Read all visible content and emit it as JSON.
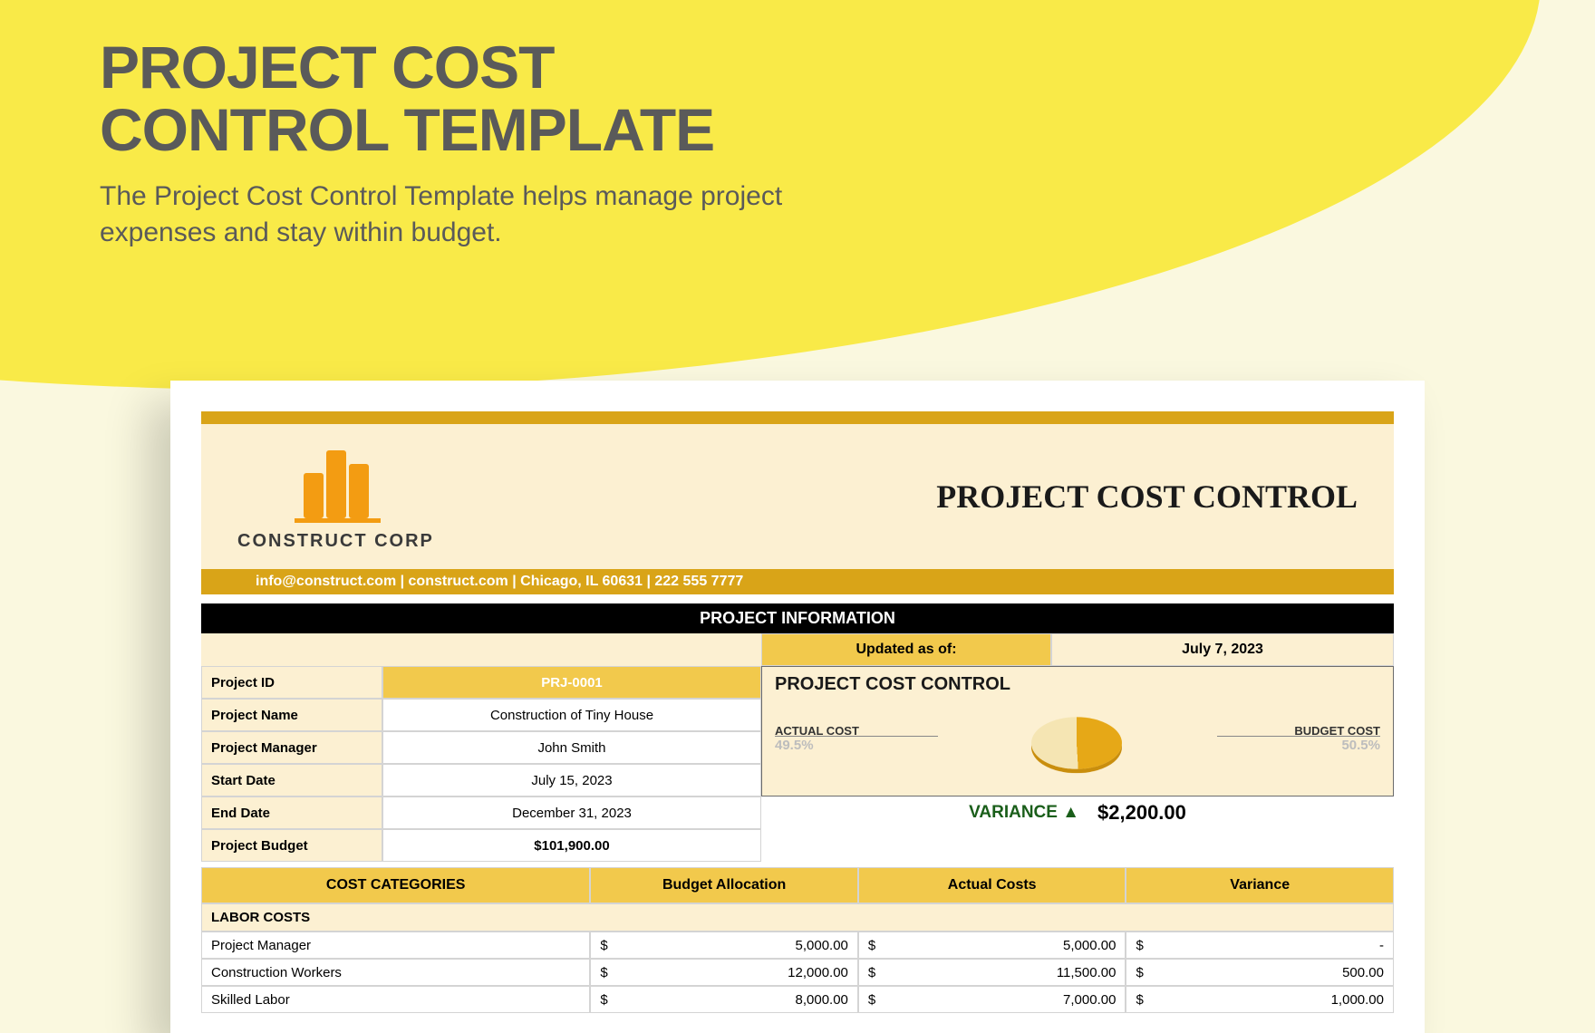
{
  "header": {
    "title_line1": "PROJECT COST",
    "title_line2": "CONTROL TEMPLATE",
    "subtitle": "The Project Cost Control Template helps manage project expenses and stay within budget."
  },
  "company": {
    "name": "CONSTRUCT CORP",
    "contact": "info@construct.com | construct.com | Chicago, IL 60631 | 222 555 7777"
  },
  "doc_title": "PROJECT COST CONTROL",
  "section_project_info": "PROJECT INFORMATION",
  "updated_label": "Updated as of:",
  "updated_value": "July 7, 2023",
  "info": {
    "project_id_label": "Project ID",
    "project_id": "PRJ-0001",
    "project_name_label": "Project Name",
    "project_name": "Construction of Tiny House",
    "project_manager_label": "Project Manager",
    "project_manager": "John Smith",
    "start_date_label": "Start Date",
    "start_date": "July 15, 2023",
    "end_date_label": "End Date",
    "end_date": "December 31, 2023",
    "project_budget_label": "Project Budget",
    "project_budget": "$101,900.00"
  },
  "chart": {
    "title": "PROJECT COST CONTROL",
    "actual_label": "ACTUAL COST",
    "actual_pct": "49.5%",
    "budget_label": "BUDGET COST",
    "budget_pct": "50.5%",
    "variance_label": "VARIANCE ▲",
    "variance_value": "$2,200.00"
  },
  "chart_data": {
    "type": "pie",
    "title": "PROJECT COST CONTROL",
    "series": [
      {
        "name": "ACTUAL COST",
        "values": [
          49.5
        ]
      },
      {
        "name": "BUDGET COST",
        "values": [
          50.5
        ]
      }
    ]
  },
  "columns": {
    "categories": "COST CATEGORIES",
    "budget": "Budget Allocation",
    "actual": "Actual Costs",
    "variance": "Variance"
  },
  "group_label": "LABOR COSTS",
  "rows": [
    {
      "name": "Project Manager",
      "budget": "5,000.00",
      "actual": "5,000.00",
      "variance": "-"
    },
    {
      "name": "Construction Workers",
      "budget": "12,000.00",
      "actual": "11,500.00",
      "variance": "500.00"
    },
    {
      "name": "Skilled Labor",
      "budget": "8,000.00",
      "actual": "7,000.00",
      "variance": "1,000.00"
    }
  ],
  "currency": "$"
}
